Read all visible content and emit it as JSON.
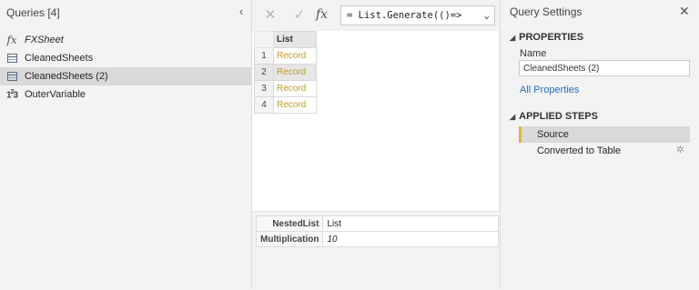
{
  "queries_pane": {
    "title": "Queries [4]",
    "collapse_glyph": "‹",
    "items": [
      {
        "label": "FXSheet",
        "icon": "function-icon",
        "italic": true
      },
      {
        "label": "CleanedSheets",
        "icon": "table-icon"
      },
      {
        "label": "CleanedSheets (2)",
        "icon": "table-icon",
        "selected": true
      },
      {
        "label": "OuterVariable",
        "icon": "number-icon"
      }
    ]
  },
  "formula_bar": {
    "cancel_glyph": "✕",
    "commit_glyph": "✓",
    "fx_glyph": "fx",
    "formula": "= List.Generate(()=>",
    "expand_glyph": "⌄"
  },
  "grid": {
    "column_header": "List",
    "rows": [
      {
        "n": "1",
        "value": "Record"
      },
      {
        "n": "2",
        "value": "Record",
        "selected": true
      },
      {
        "n": "3",
        "value": "Record"
      },
      {
        "n": "4",
        "value": "Record"
      }
    ]
  },
  "detail": {
    "rows": [
      {
        "key": "NestedList",
        "value": "List"
      },
      {
        "key": "Multiplication",
        "value": "10"
      }
    ]
  },
  "settings": {
    "title": "Query Settings",
    "close_glyph": "✕",
    "properties_heading": "PROPERTIES",
    "name_label": "Name",
    "name_value": "CleanedSheets (2)",
    "all_properties": "All Properties",
    "applied_steps_heading": "APPLIED STEPS",
    "steps": [
      {
        "label": "Source",
        "selected": true
      },
      {
        "label": "Converted to Table",
        "has_gear": true
      }
    ]
  },
  "colors": {
    "record_link": "#c49a2a",
    "accent_link": "#1f6fc5",
    "step_marker": "#e3b341"
  }
}
